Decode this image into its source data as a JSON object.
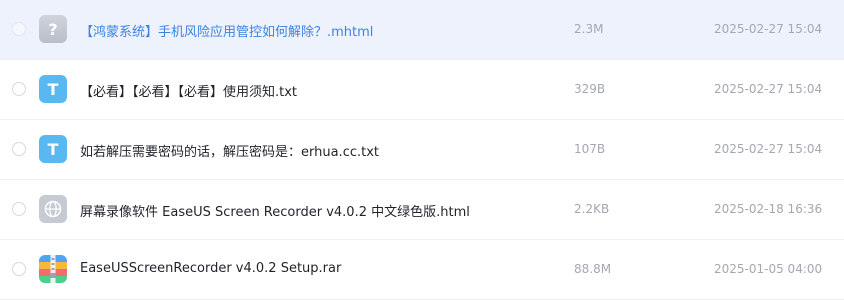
{
  "files": [
    {
      "name": "【鸿蒙系统】手机风险应用管控如何解除？.mhtml",
      "size": "2.3M",
      "date": "2025-02-27 15:04",
      "icon": "unknown-file-icon",
      "selected": true
    },
    {
      "name": "【必看】【必看】【必看】使用须知.txt",
      "size": "329B",
      "date": "2025-02-27 15:04",
      "icon": "text-file-icon",
      "icon_text": "T"
    },
    {
      "name": "如若解压需要密码的话，解压密码是：erhua.cc.txt",
      "size": "107B",
      "date": "2025-02-27 15:04",
      "icon": "text-file-icon",
      "icon_text": "T"
    },
    {
      "name": "屏幕录像软件 EaseUS Screen Recorder v4.0.2 中文绿色版.html",
      "size": "2.2KB",
      "date": "2025-02-18 16:36",
      "icon": "web-file-icon"
    },
    {
      "name": "EaseUSScreenRecorder v4.0.2 Setup.rar",
      "size": "88.8M",
      "date": "2025-01-05 04:00",
      "icon": "archive-file-icon"
    }
  ],
  "colors": {
    "selected_row": "#edf2fd",
    "selected_text": "#3c83e0",
    "text_icon": "#58b9f2",
    "muted_text": "#a3a8b1"
  }
}
